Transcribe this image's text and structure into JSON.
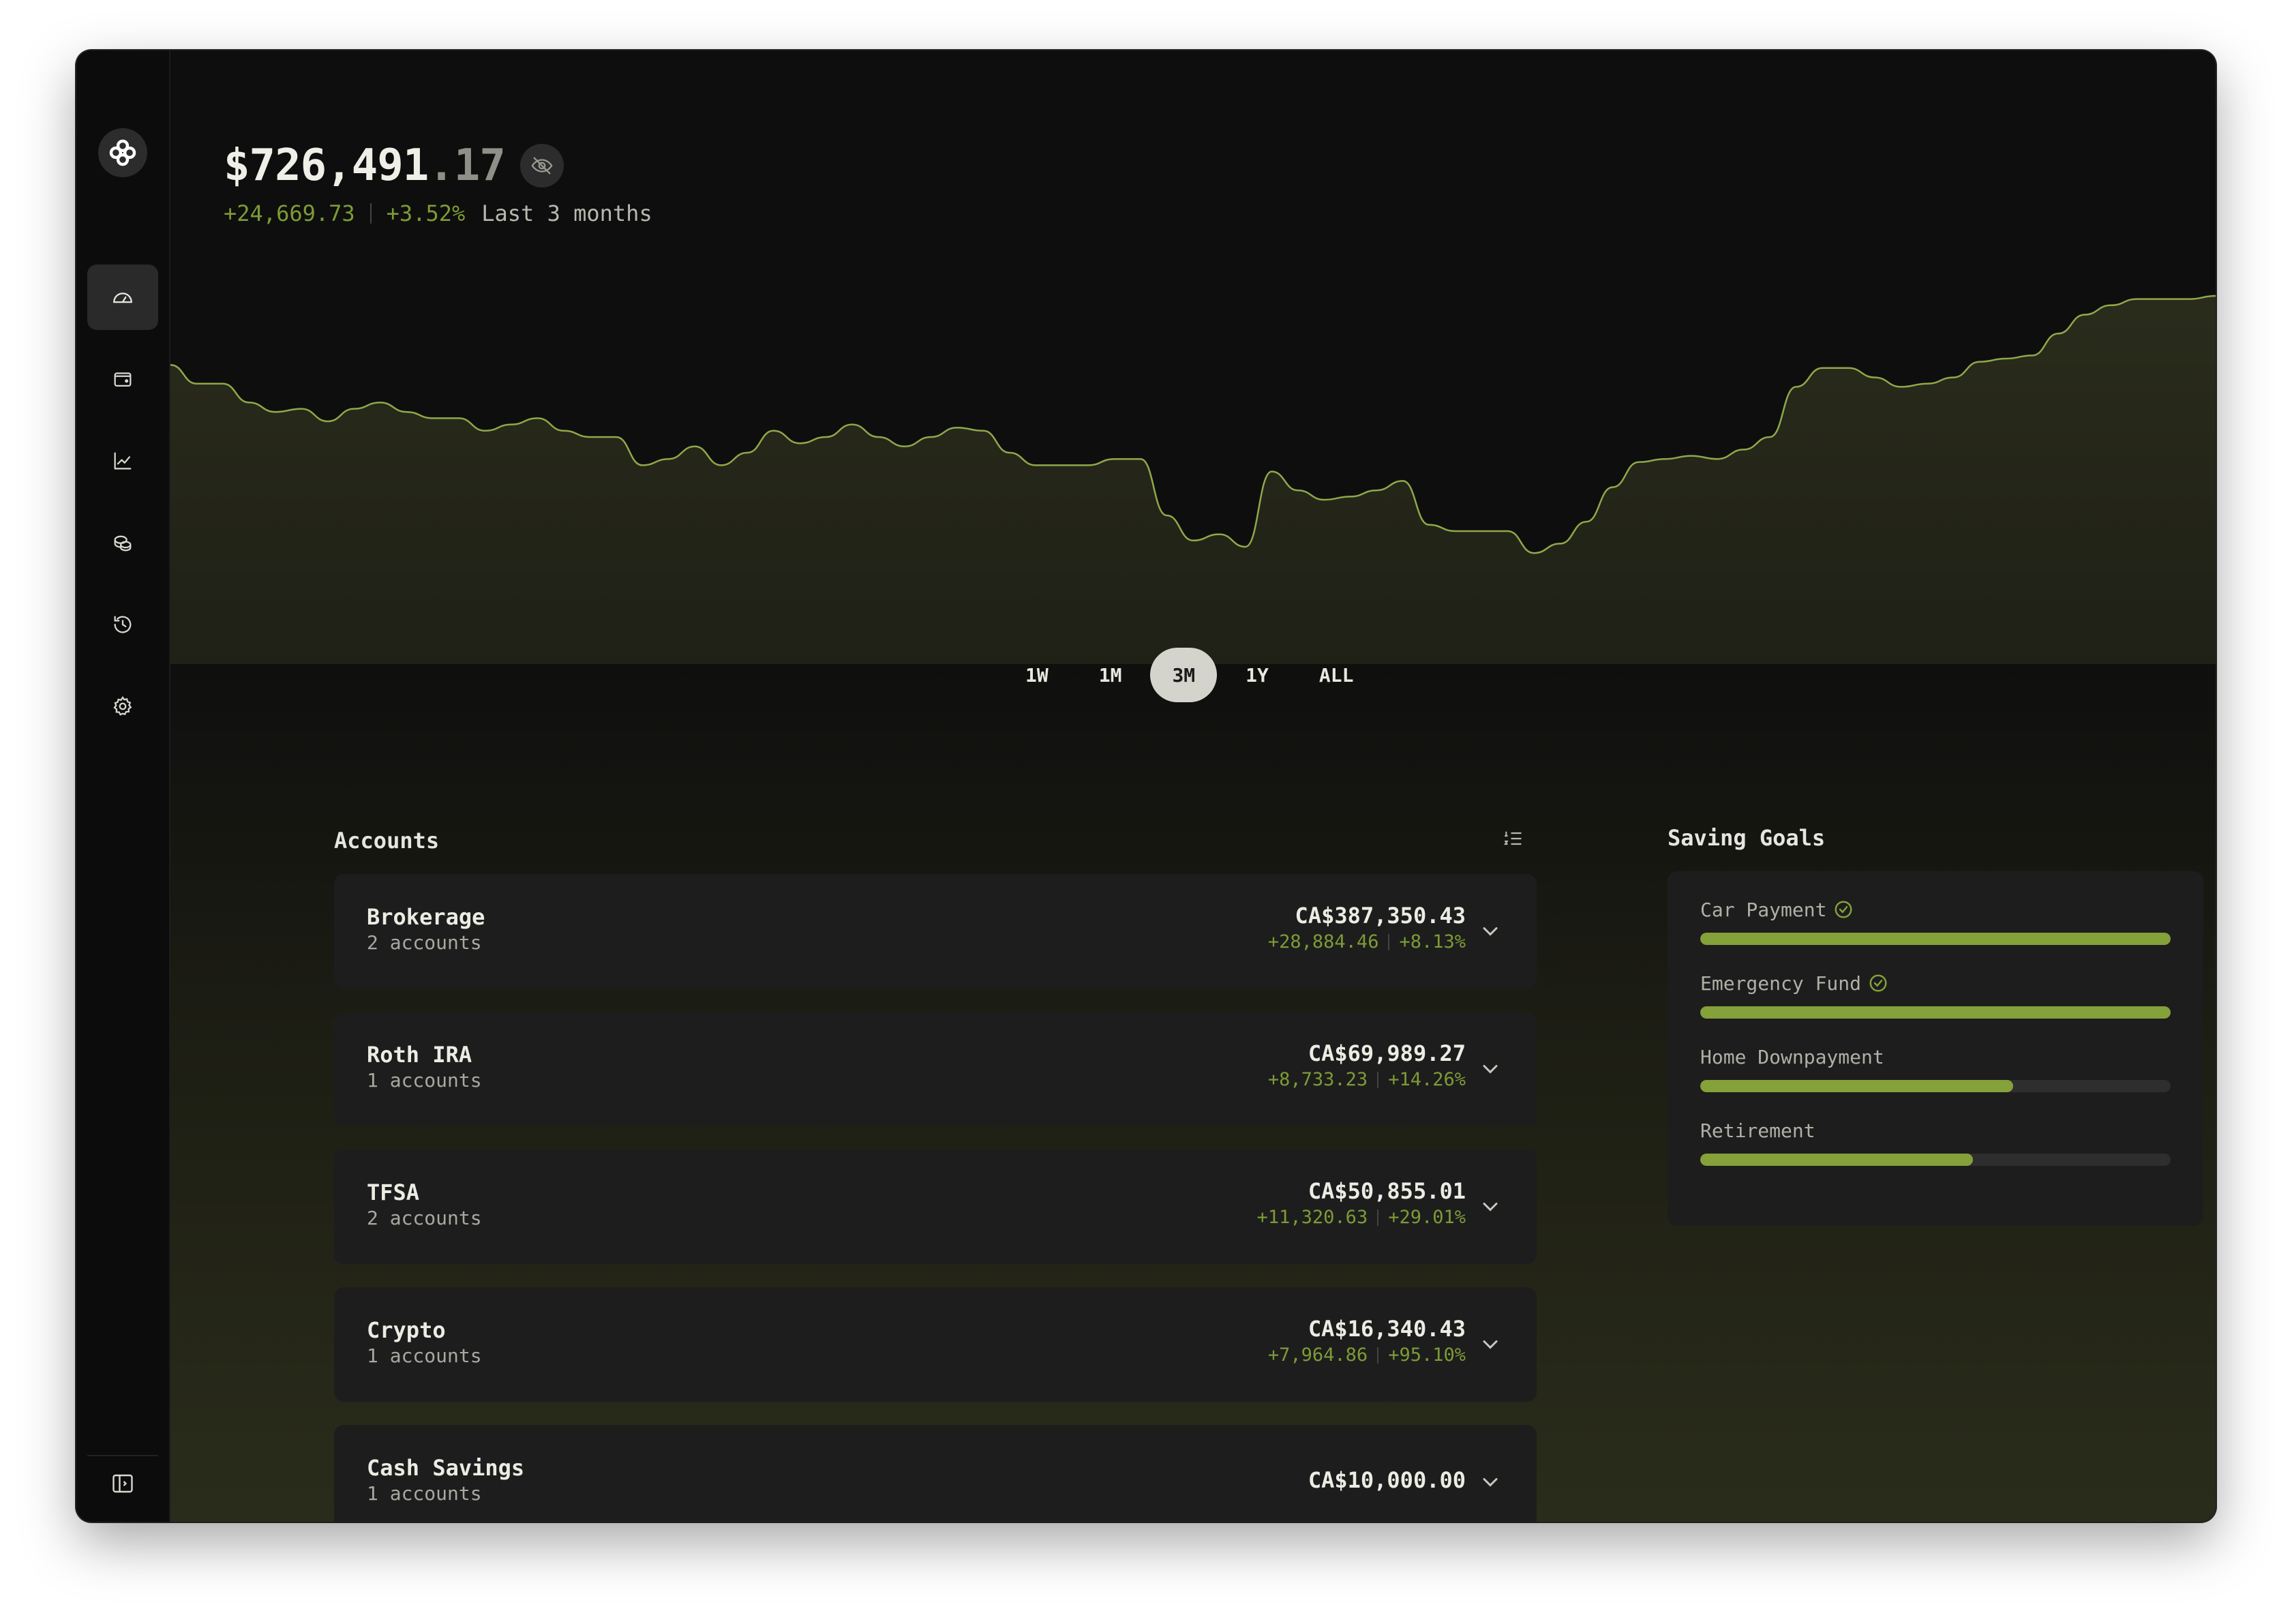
{
  "balance": {
    "main": "$726,491",
    "cents": ".17"
  },
  "change": {
    "amount": "+24,669.73",
    "percent": "+3.52%",
    "period": "Last 3 months"
  },
  "range_tabs": [
    {
      "label": "1W",
      "active": false
    },
    {
      "label": "1M",
      "active": false
    },
    {
      "label": "3M",
      "active": true
    },
    {
      "label": "1Y",
      "active": false
    },
    {
      "label": "ALL",
      "active": false
    }
  ],
  "nav": {
    "items": [
      {
        "icon": "gauge-icon",
        "active": true
      },
      {
        "icon": "wallet-icon",
        "active": false
      },
      {
        "icon": "trend-chart-icon",
        "active": false
      },
      {
        "icon": "coins-icon",
        "active": false
      },
      {
        "icon": "history-icon",
        "active": false
      },
      {
        "icon": "gear-icon",
        "active": false
      }
    ]
  },
  "accounts": {
    "title": "Accounts",
    "items": [
      {
        "name": "Brokerage",
        "sub": "2 accounts",
        "value": "CA$387,350.43",
        "change": "+28,884.46",
        "percent": "+8.13%"
      },
      {
        "name": "Roth IRA",
        "sub": "1 accounts",
        "value": "CA$69,989.27",
        "change": "+8,733.23",
        "percent": "+14.26%"
      },
      {
        "name": "TFSA",
        "sub": "2 accounts",
        "value": "CA$50,855.01",
        "change": "+11,320.63",
        "percent": "+29.01%"
      },
      {
        "name": "Crypto",
        "sub": "1 accounts",
        "value": "CA$16,340.43",
        "change": "+7,964.86",
        "percent": "+95.10%"
      },
      {
        "name": "Cash Savings",
        "sub": "1 accounts",
        "value": "CA$10,000.00",
        "change": "",
        "percent": ""
      }
    ]
  },
  "goals": {
    "title": "Saving Goals",
    "items": [
      {
        "label": "Car Payment",
        "complete": true,
        "progress": 1.0
      },
      {
        "label": "Emergency Fund",
        "complete": true,
        "progress": 1.0
      },
      {
        "label": "Home Downpayment",
        "complete": false,
        "progress": 0.665
      },
      {
        "label": "Retirement",
        "complete": false,
        "progress": 0.58
      }
    ]
  },
  "colors": {
    "accent": "#84a13a",
    "positive": "#7d9b36",
    "chart_line": "#8fa84a"
  },
  "chart_data": {
    "type": "area",
    "period": "3M",
    "values": [
      0.78,
      0.72,
      0.72,
      0.66,
      0.63,
      0.64,
      0.6,
      0.64,
      0.66,
      0.63,
      0.61,
      0.61,
      0.57,
      0.59,
      0.61,
      0.57,
      0.55,
      0.55,
      0.46,
      0.48,
      0.52,
      0.46,
      0.5,
      0.57,
      0.53,
      0.55,
      0.59,
      0.55,
      0.52,
      0.55,
      0.58,
      0.57,
      0.5,
      0.46,
      0.46,
      0.46,
      0.48,
      0.48,
      0.3,
      0.22,
      0.24,
      0.2,
      0.44,
      0.38,
      0.35,
      0.36,
      0.38,
      0.41,
      0.27,
      0.25,
      0.25,
      0.25,
      0.18,
      0.21,
      0.28,
      0.39,
      0.47,
      0.48,
      0.49,
      0.48,
      0.51,
      0.55,
      0.71,
      0.77,
      0.77,
      0.74,
      0.71,
      0.72,
      0.74,
      0.79,
      0.8,
      0.81,
      0.88,
      0.94,
      0.97,
      0.99,
      0.99,
      0.99,
      1.0
    ]
  }
}
